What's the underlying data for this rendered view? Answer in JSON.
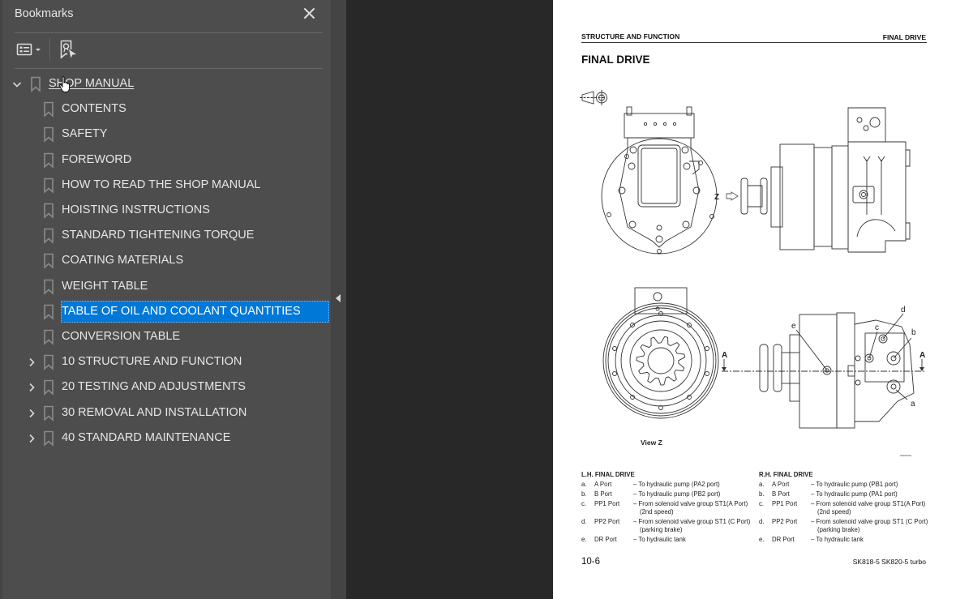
{
  "bookmarks_panel": {
    "title": "Bookmarks",
    "close_icon": "close-icon",
    "toolbar": {
      "options_icon": "list-options-icon",
      "find_current_icon": "find-current-bookmark-icon"
    },
    "collapse_icon": "collapse-left-arrow-icon",
    "items": [
      {
        "label": "SHOP MANUAL",
        "level": 0,
        "expandable": true,
        "expanded": true,
        "hovered": true
      },
      {
        "label": "CONTENTS",
        "level": 1,
        "expandable": false
      },
      {
        "label": "SAFETY",
        "level": 1,
        "expandable": false
      },
      {
        "label": "FOREWORD",
        "level": 1,
        "expandable": false
      },
      {
        "label": "HOW TO READ THE SHOP MANUAL",
        "level": 1,
        "expandable": false
      },
      {
        "label": "HOISTING INSTRUCTIONS",
        "level": 1,
        "expandable": false
      },
      {
        "label": "STANDARD TIGHTENING TORQUE",
        "level": 1,
        "expandable": false
      },
      {
        "label": "COATING MATERIALS",
        "level": 1,
        "expandable": false
      },
      {
        "label": "WEIGHT TABLE",
        "level": 1,
        "expandable": false
      },
      {
        "label": "TABLE OF OIL AND COOLANT QUANTITIES",
        "level": 1,
        "expandable": false,
        "selected": true
      },
      {
        "label": "CONVERSION TABLE",
        "level": 1,
        "expandable": false
      },
      {
        "label": "10 STRUCTURE AND FUNCTION",
        "level": 1,
        "expandable": true,
        "expanded": false
      },
      {
        "label": "20 TESTING AND ADJUSTMENTS",
        "level": 1,
        "expandable": true,
        "expanded": false
      },
      {
        "label": "30 REMOVAL AND INSTALLATION",
        "level": 1,
        "expandable": true,
        "expanded": false
      },
      {
        "label": "40 STANDARD MAINTENANCE",
        "level": 1,
        "expandable": true,
        "expanded": false
      }
    ]
  },
  "colors": {
    "panel_bg": "#4d4d4d",
    "canvas_bg": "#282828",
    "selection": "#0078d7",
    "text": "#e6e6e6"
  },
  "document_page": {
    "header_left": "STRUCTURE AND FUNCTION",
    "header_right": "FINAL DRIVE",
    "title": "FINAL DRIVE",
    "figure": {
      "view_z_label": "View Z",
      "z_label": "Z",
      "section_label": "A",
      "callouts": [
        "a",
        "b",
        "c",
        "d",
        "e"
      ]
    },
    "lh": {
      "heading": "L.H. FINAL DRIVE",
      "rows": [
        {
          "key": "a.",
          "port": "A Port",
          "desc": "– To hydraulic pump (PA2 port)",
          "desc2": ""
        },
        {
          "key": "b.",
          "port": "B Port",
          "desc": "– To hydraulic pump (PB2 port)",
          "desc2": ""
        },
        {
          "key": "c.",
          "port": "PP1 Port",
          "desc": "– From solenoid valve group ST1(A Port)",
          "desc2": "(2nd speed)"
        },
        {
          "key": "d.",
          "port": "PP2 Port",
          "desc": "– From solenoid valve group ST1 (C Port)",
          "desc2": "(parking brake)"
        },
        {
          "key": "e.",
          "port": "DR Port",
          "desc": "– To hydraulic tank",
          "desc2": ""
        }
      ]
    },
    "rh": {
      "heading": "R.H. FINAL DRIVE",
      "rows": [
        {
          "key": "a.",
          "port": "A Port",
          "desc": "– To hydraulic pump (PB1 port)",
          "desc2": ""
        },
        {
          "key": "b.",
          "port": "B Port",
          "desc": "– To hydraulic pump (PA1 port)",
          "desc2": ""
        },
        {
          "key": "c.",
          "port": "PP1 Port",
          "desc": "– From solenoid valve group ST1(A Port)",
          "desc2": "(2nd speed)"
        },
        {
          "key": "d.",
          "port": "PP2 Port",
          "desc": "– From solenoid valve group ST1 (C Port)",
          "desc2": "(parking brake)"
        },
        {
          "key": "e.",
          "port": "DR Port",
          "desc": "– To hydraulic tank",
          "desc2": ""
        }
      ]
    },
    "page_number": "10-6",
    "model": "SK818-5  SK820-5 turbo"
  }
}
